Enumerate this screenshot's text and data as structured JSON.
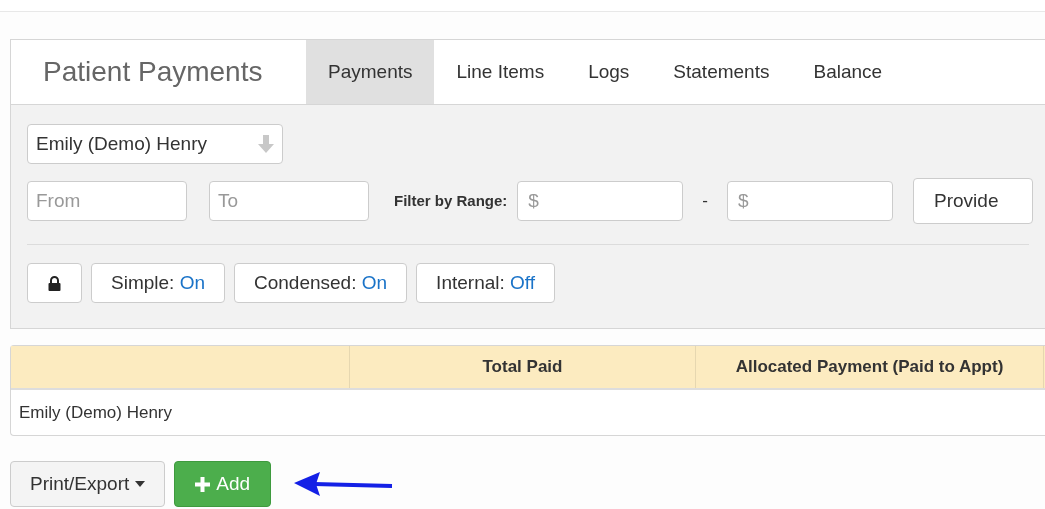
{
  "panel": {
    "title": "Patient Payments"
  },
  "tabs": [
    {
      "label": "Payments",
      "selected": true
    },
    {
      "label": "Line Items",
      "selected": false
    },
    {
      "label": "Logs",
      "selected": false
    },
    {
      "label": "Statements",
      "selected": false
    },
    {
      "label": "Balance",
      "selected": false
    }
  ],
  "filters": {
    "patient": "Emily (Demo) Henry",
    "from_placeholder": "From",
    "to_placeholder": "To",
    "range_label": "Filter by Range:",
    "min_placeholder": "$",
    "separator": "-",
    "max_placeholder": "$",
    "provider_button": "Provide"
  },
  "toggles": [
    {
      "label": "Simple:",
      "value": "On"
    },
    {
      "label": "Condensed:",
      "value": "On"
    },
    {
      "label": "Internal:",
      "value": "Off"
    }
  ],
  "table": {
    "columns": [
      "Total Paid",
      "Allocated Payment (Paid to Appt)"
    ],
    "rows": [
      {
        "name": "Emily (Demo) Henry"
      }
    ]
  },
  "actions": {
    "print_export": "Print/Export",
    "add": "Add"
  }
}
